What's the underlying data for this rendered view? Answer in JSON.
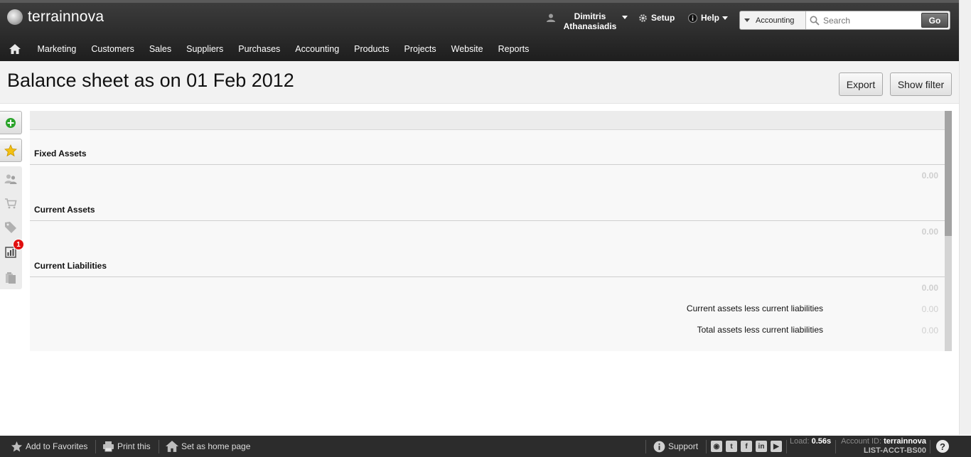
{
  "header": {
    "app_name": "terrainnova",
    "user": {
      "first_name": "Dimitris",
      "last_name": "Athanasiadis"
    },
    "setup_label": "Setup",
    "help_label": "Help",
    "search": {
      "module": "Accounting",
      "placeholder": "Search",
      "go_label": "Go"
    }
  },
  "nav": {
    "items": [
      "Marketing",
      "Customers",
      "Sales",
      "Suppliers",
      "Purchases",
      "Accounting",
      "Products",
      "Projects",
      "Website",
      "Reports"
    ]
  },
  "page": {
    "title": "Balance sheet as on 01 Feb 2012",
    "export_label": "Export",
    "show_filter_label": "Show filter"
  },
  "sidebar": {
    "notification_count": "1",
    "icons": [
      "add-icon",
      "favorites-star-icon",
      "contacts-icon",
      "cart-icon",
      "tag-icon",
      "reports-chart-icon",
      "clipboard-icon"
    ]
  },
  "report": {
    "sections": [
      {
        "label": "Fixed Assets",
        "total": "0.00"
      },
      {
        "label": "Current Assets",
        "total": "0.00"
      },
      {
        "label": "Current Liabilities",
        "total": "0.00"
      }
    ],
    "summary": [
      {
        "label": "Current assets less current liabilities",
        "value": "0.00"
      },
      {
        "label": "Total assets less current liabilities",
        "value": "0.00"
      }
    ]
  },
  "footer": {
    "add_favorites": "Add to Favorites",
    "print": "Print this",
    "set_home": "Set as home page",
    "support": "Support",
    "load_label": "Load:",
    "load_value": "0.56s",
    "account_label": "Account ID:",
    "account_value": "terrainnova",
    "page_code": "LIST-ACCT-BS00",
    "help_symbol": "?"
  },
  "colors": {
    "header_dark": "#2a2a2a",
    "badge_red": "#e01010",
    "add_green": "#2aa32a",
    "star_yellow": "#f3c012"
  }
}
